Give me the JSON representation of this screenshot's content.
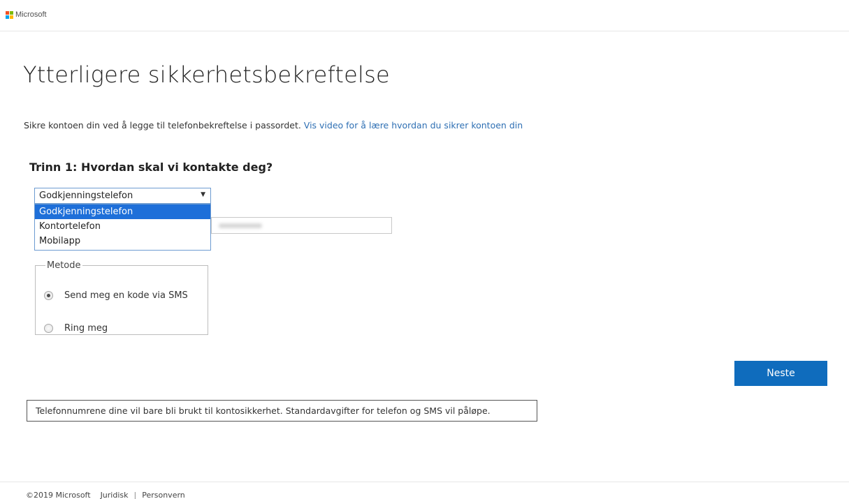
{
  "header": {
    "brand": "Microsoft"
  },
  "main": {
    "title": "Ytterligere sikkerhetsbekreftelse",
    "intro_text": "Sikre kontoen din ved å legge til telefonbekreftelse i passordet. ",
    "intro_link": "Vis video for å lære hvordan du sikrer kontoen din",
    "step_heading": "Trinn 1: Hvordan skal vi kontakte deg?",
    "contact_select": {
      "selected": "Godkjenningstelefon",
      "options": [
        "Godkjenningstelefon",
        "Kontortelefon",
        "Mobilapp"
      ]
    },
    "method": {
      "legend": "Metode",
      "options": [
        {
          "label": "Send meg en kode via SMS",
          "checked": true
        },
        {
          "label": "Ring meg",
          "checked": false
        }
      ]
    },
    "next_label": "Neste",
    "notice": "Telefonnumrene dine vil bare bli brukt til kontosikkerhet. Standardavgifter for telefon og SMS vil påløpe."
  },
  "footer": {
    "copyright": "©2019 Microsoft",
    "legal": "Juridisk",
    "separator": "|",
    "privacy": "Personvern"
  },
  "colors": {
    "accent": "#0f6cbd",
    "link": "#2e6fb3",
    "dropdown_highlight": "#1e6fd9"
  }
}
